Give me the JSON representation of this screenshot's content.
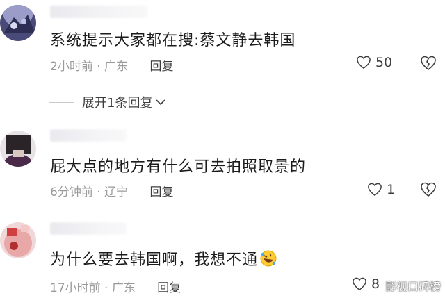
{
  "comments": [
    {
      "text": "系统提示大家都在搜:蔡文静去韩国",
      "time": "2小时前",
      "location": "广东",
      "reply_label": "回复",
      "likes": "50"
    },
    {
      "text": "屁大点的地方有什么可去拍照取景的",
      "time": "6分钟前",
      "location": "辽宁",
      "reply_label": "回复",
      "likes": "1"
    },
    {
      "text": "为什么要去韩国啊，我想不通",
      "time": "17小时前",
      "location": "广东",
      "reply_label": "回复",
      "likes": "8"
    }
  ],
  "expand_replies": "展开1条回复",
  "watermark": "影视口碑榜",
  "icons": {
    "like": "heart-outline-icon",
    "dislike": "broken-heart-outline-icon",
    "expand": "chevron-down-icon",
    "emoji": "rolling-laughing-emoji-icon"
  },
  "colors": {
    "text": "#1b1b1b",
    "meta": "#9a9a9a",
    "action": "#3c3c3c"
  }
}
